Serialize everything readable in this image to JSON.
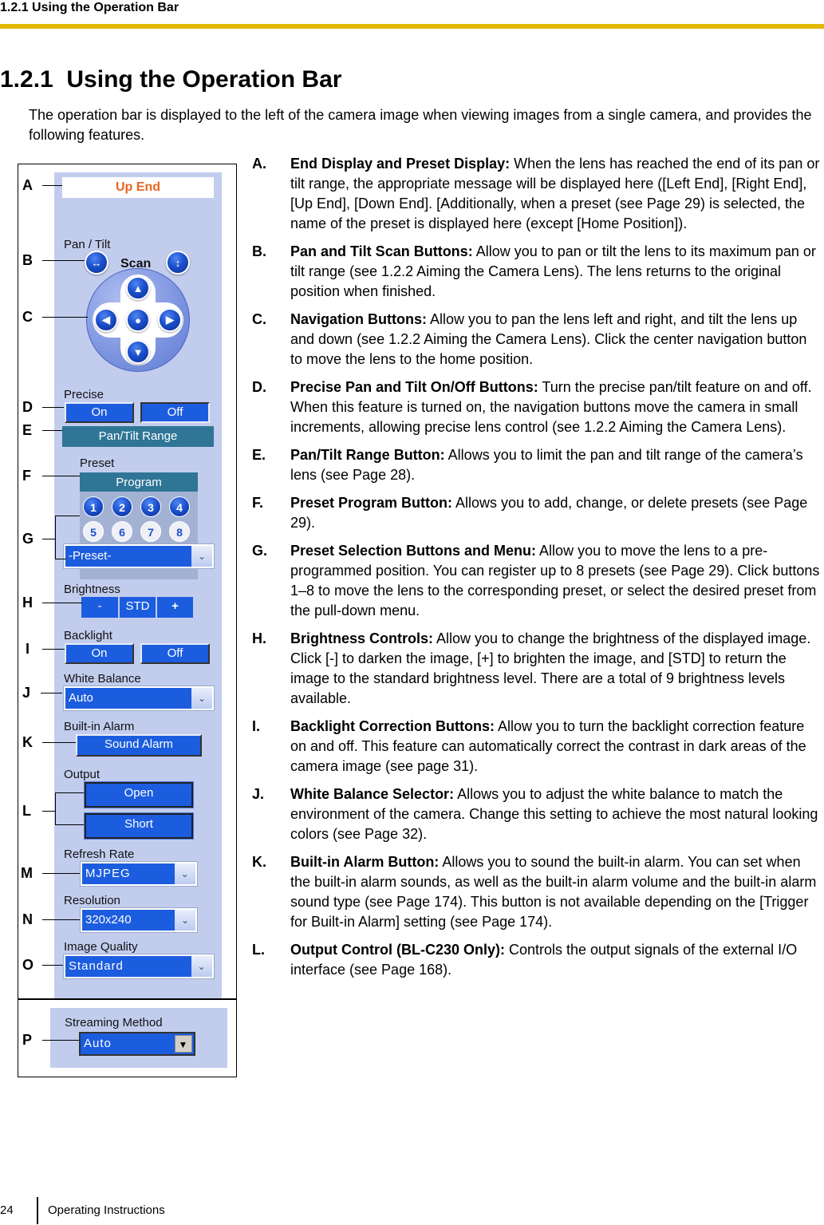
{
  "running_header": "1.2.1 Using the Operation Bar",
  "page_title": "1.2.1  Using the Operation Bar",
  "intro": "The operation bar is displayed to the left of the camera image when viewing images from a single camera, and provides the following features.",
  "colors": {
    "header_rule": "#e0b800",
    "panel_bg": "#c2cdee",
    "button_blue": "#1c5ddf",
    "teal_button": "#2f7596",
    "status_text": "#e8661f"
  },
  "figure": {
    "callouts": [
      "A",
      "B",
      "C",
      "D",
      "E",
      "F",
      "G",
      "H",
      "I",
      "J",
      "K",
      "L",
      "M",
      "N",
      "O",
      "P"
    ],
    "status_display": "Up End",
    "pan_tilt_label": "Pan / Tilt",
    "scan_label": "Scan",
    "pan_scan_icon": "horizontal-arrows-icon",
    "tilt_scan_icon": "vertical-arrows-icon",
    "nav": {
      "up": "▲",
      "down": "▼",
      "left": "◀",
      "right": "▶",
      "home": "●"
    },
    "precise_label": "Precise",
    "precise_on": "On",
    "precise_off": "Off",
    "pan_tilt_range": "Pan/Tilt Range",
    "preset_label": "Preset",
    "program": "Program",
    "preset_buttons": [
      "1",
      "2",
      "3",
      "4",
      "5",
      "6",
      "7",
      "8"
    ],
    "preset_select": "-Preset-",
    "brightness_label": "Brightness",
    "brightness_minus": "-",
    "brightness_std": "STD",
    "brightness_plus": "+",
    "backlight_label": "Backlight",
    "backlight_on": "On",
    "backlight_off": "Off",
    "white_balance_label": "White Balance",
    "white_balance_value": "Auto",
    "alarm_label": "Built-in Alarm",
    "sound_alarm": "Sound Alarm",
    "output_label": "Output",
    "output_open": "Open",
    "output_short": "Short",
    "refresh_label": "Refresh Rate",
    "refresh_value": "MJPEG",
    "resolution_label": "Resolution",
    "resolution_value": "320x240",
    "quality_label": "Image Quality",
    "quality_value": "Standard",
    "streaming_label": "Streaming Method",
    "streaming_value": "Auto",
    "dropdown_glyph": "⌄",
    "classic_dropdown_glyph": "▼"
  },
  "descriptions": [
    {
      "letter": "A.",
      "title": "End Display and Preset Display:",
      "text": " When the lens has reached the end of its pan or tilt range, the appropriate message will be displayed here ([Left End], [Right End], [Up End], [Down End]. [Additionally, when a preset (see Page 29) is selected, the name of the preset is displayed here (except [Home Position])."
    },
    {
      "letter": "B.",
      "title": "Pan and Tilt Scan Buttons:",
      "text": " Allow you to pan or tilt the lens to its maximum pan or tilt range (see 1.2.2  Aiming the Camera Lens). The lens returns to the original position when finished."
    },
    {
      "letter": "C.",
      "title": "Navigation Buttons:",
      "text": " Allow you to pan the lens left and right, and tilt the lens up and down (see 1.2.2  Aiming the Camera Lens). Click the center navigation button to move the lens to the home position."
    },
    {
      "letter": "D.",
      "title": "Precise Pan and Tilt On/Off Buttons:",
      "text": " Turn the precise pan/tilt feature on and off. When this feature is turned on, the navigation buttons move the camera in small increments, allowing precise lens control (see 1.2.2  Aiming the Camera Lens)."
    },
    {
      "letter": "E.",
      "title": "Pan/Tilt Range Button:",
      "text": " Allows you to limit the pan and tilt range of the camera’s lens (see Page 28)."
    },
    {
      "letter": "F.",
      "title": "Preset Program Button:",
      "text": " Allows you to add, change, or delete presets (see Page 29)."
    },
    {
      "letter": "G.",
      "title": "Preset Selection Buttons and Menu:",
      "text": " Allow you to move the lens to a pre-programmed position. You can register up to 8 presets (see Page 29). Click buttons 1–8 to move the lens to the corresponding preset, or select the desired preset from the pull-down menu."
    },
    {
      "letter": "H.",
      "title": "Brightness Controls:",
      "text": " Allow you to change the brightness of the displayed image. Click [-] to darken the image, [+] to brighten the image, and [STD] to return the image to the standard brightness level. There are a total of 9 brightness levels available."
    },
    {
      "letter": "I.",
      "title": "Backlight Correction Buttons:",
      "text": " Allow you to turn the backlight correction feature on and off. This feature can automatically correct the contrast in dark areas of the camera image (see page 31)."
    },
    {
      "letter": "J.",
      "title": "White Balance Selector:",
      "text": " Allows you to adjust the white balance to match the environment of the camera. Change this setting to achieve the most natural looking colors (see Page 32)."
    },
    {
      "letter": "K.",
      "title": "Built-in Alarm Button:",
      "text": " Allows you to sound the built-in alarm. You can set when the built-in alarm sounds, as well as the built-in alarm volume and the built-in alarm sound type (see Page 174). This button is not available depending on the [Trigger for Built-in Alarm] setting (see Page 174)."
    },
    {
      "letter": "L.",
      "title": "Output Control (BL-C230 Only):",
      "text": " Controls the output signals of the external I/O interface (see Page 168)."
    }
  ],
  "footer": {
    "page_number": "24",
    "text": "Operating Instructions"
  }
}
